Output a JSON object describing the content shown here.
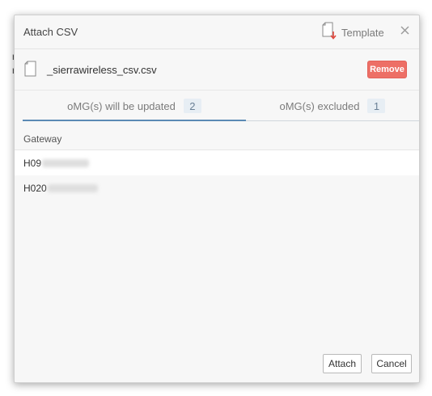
{
  "background": {
    "fragments": [
      "r",
      "r"
    ]
  },
  "dialog": {
    "title": "Attach CSV",
    "template_label": "Template",
    "icons": {
      "template": "file-download-icon",
      "close": "close-icon",
      "file": "file-icon"
    }
  },
  "file": {
    "name": "_sierrawireless_csv.csv",
    "remove_label": "Remove"
  },
  "tabs": [
    {
      "label": "oMG(s) will be updated",
      "count": "2",
      "active": true
    },
    {
      "label": "oMG(s) excluded",
      "count": "1",
      "active": false
    }
  ],
  "table": {
    "column_header": "Gateway",
    "rows": [
      {
        "visible_prefix": "H09"
      },
      {
        "visible_prefix": "H020"
      }
    ]
  },
  "footer": {
    "attach_label": "Attach",
    "cancel_label": "Cancel"
  },
  "colors": {
    "accent": "#5b8ab5",
    "remove": "#ed6f66",
    "tab_count_bg": "#e7eef4",
    "dialog_bg": "#f7f7f7"
  }
}
